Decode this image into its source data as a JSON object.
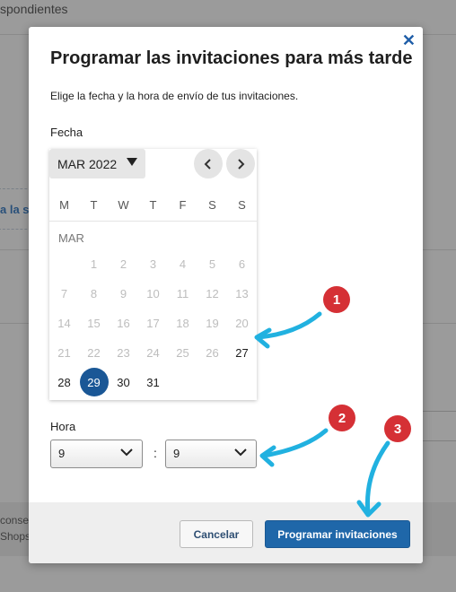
{
  "background": {
    "header_fragment": "spondientes",
    "link_fragment": "a la se",
    "footer_fragment_1": "conse",
    "footer_fragment_2": "Shops"
  },
  "modal": {
    "title": "Programar las invitaciones para más tarde",
    "description": "Elige la fecha y la hora de envío de tus invitaciones.",
    "close_icon": "close-icon",
    "date_label": "Fecha",
    "time_label": "Hora"
  },
  "calendar": {
    "month_select": "MAR 2022",
    "prev_icon": "chevron-left-icon",
    "next_icon": "chevron-right-icon",
    "weekdays": [
      "M",
      "T",
      "W",
      "T",
      "F",
      "S",
      "S"
    ],
    "month_label": "MAR",
    "days": [
      "1",
      "2",
      "3",
      "4",
      "5",
      "6",
      "7",
      "8",
      "9",
      "10",
      "11",
      "12",
      "13",
      "14",
      "15",
      "16",
      "17",
      "18",
      "19",
      "20",
      "21",
      "22",
      "23",
      "24",
      "25",
      "26",
      "27",
      "28",
      "29",
      "30",
      "31"
    ],
    "selected_day": "29",
    "first_enabled_day": 27,
    "colors": {
      "selected": "#1a5796",
      "disabled": "#bdbdbd"
    }
  },
  "time": {
    "hour_value": "9",
    "minute_value": "9",
    "separator": ":"
  },
  "footer": {
    "cancel_label": "Cancelar",
    "submit_label": "Programar invitaciones"
  },
  "annotations": {
    "badges": [
      "1",
      "2",
      "3"
    ],
    "arrow_color": "#21b1e0",
    "badge_color": "#d53035"
  }
}
